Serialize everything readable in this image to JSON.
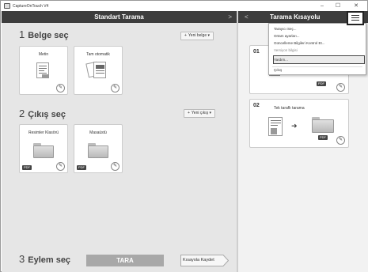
{
  "window": {
    "title": "CaptureOnTouch V4",
    "min_label": "–",
    "max_label": "☐",
    "close_label": "✕"
  },
  "left_header": {
    "title": "Standart Tarama",
    "chevron": ">"
  },
  "right_header": {
    "title": "Tarama Kısayolu",
    "chevron": "<"
  },
  "section1": {
    "number": "1",
    "title": "Belge seç",
    "new_button": "Yeni belge",
    "cards": [
      {
        "label": "Metin"
      },
      {
        "label": "Tam otomatik"
      }
    ]
  },
  "section2": {
    "number": "2",
    "title": "Çıkış seç",
    "new_button": "Yeni çıkış",
    "cards": [
      {
        "label": "Resimler Klasörü",
        "badge": "PDF"
      },
      {
        "label": "Masaüstü",
        "badge": "PDF"
      }
    ]
  },
  "section3": {
    "number": "3",
    "title": "Eylem seç",
    "scan_button": "TARA",
    "save_shortcut_button": "Kısayola Kaydet"
  },
  "shortcuts": [
    {
      "number": "01",
      "badge": "PDF"
    },
    {
      "number": "02",
      "title": "Tek taraflı tarama",
      "badge": "PDF"
    }
  ],
  "menu": {
    "items": [
      "Tarayıcı Seç...",
      "Ortam ayarları...",
      "Güncelleme Bilgileri Kontrol Et...",
      "Versiyon bilgisi",
      "Yardım...",
      "Çıkış"
    ],
    "highlighted_index": 4
  },
  "icons": {
    "edit": "pencil-icon",
    "plus": "plus-icon",
    "dropdown": "caret-down-icon",
    "menu": "hamburger-menu-icon",
    "arrow": "arrow-right-icon"
  },
  "glyphs": {
    "plus": "+",
    "caret": "▾",
    "pencil": "✎",
    "arrow": "➜"
  },
  "colors": {
    "header_bg": "#3d3d3d",
    "panel_bg": "#e6e6e6",
    "scan_button_bg": "#a8a8a8"
  }
}
